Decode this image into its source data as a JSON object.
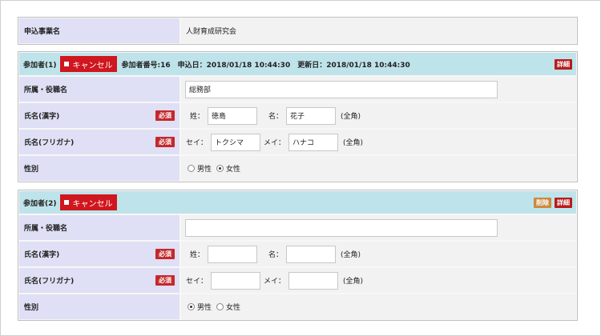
{
  "top": {
    "label": "申込事業名",
    "value": "人財育成研究会"
  },
  "participants": [
    {
      "title": "参加者(1)",
      "cancel_label": "キャンセル",
      "meta": "参加者番号:16　申込日：2018/01/18 10:44:30　更新日：2018/01/18 10:44:30",
      "detail_label": "詳細",
      "dept_label": "所属・役職名",
      "dept_value": "総務部",
      "name_kanji_label": "氏名(漢字)",
      "name_kana_label": "氏名(フリガナ)",
      "required": "必須",
      "sei_label": "姓：",
      "mei_label": "名：",
      "sei_kana_label": "セイ：",
      "mei_kana_label": "メイ：",
      "sei": "徳島",
      "mei": "花子",
      "sei_kana": "トクシマ",
      "mei_kana": "ハナコ",
      "zenkaku": "(全角)",
      "gender_label": "性別",
      "male": "男性",
      "female": "女性",
      "selected_gender": "female"
    },
    {
      "title": "参加者(2)",
      "cancel_label": "キャンセル",
      "delete_label": "削除",
      "detail_label": "詳細",
      "dept_label": "所属・役職名",
      "dept_value": "",
      "name_kanji_label": "氏名(漢字)",
      "name_kana_label": "氏名(フリガナ)",
      "required": "必須",
      "sei_label": "姓：",
      "mei_label": "名：",
      "sei_kana_label": "セイ：",
      "mei_kana_label": "メイ：",
      "sei": "",
      "mei": "",
      "sei_kana": "",
      "mei_kana": "",
      "zenkaku": "(全角)",
      "gender_label": "性別",
      "male": "男性",
      "female": "女性",
      "selected_gender": "male"
    }
  ]
}
